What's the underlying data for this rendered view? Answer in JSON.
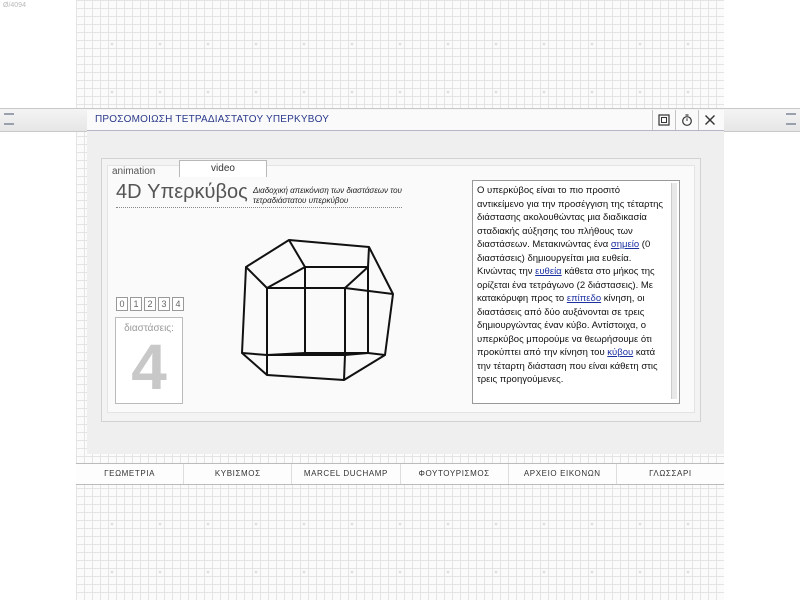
{
  "corner_label": "Ø/4094",
  "window": {
    "title": "ΠΡΟΣΟΜΟΙΩΣΗ ΤΕΤΡΑΔΙΑΣΤΑΤΟΥ ΥΠΕΡΚΥΒΟΥ"
  },
  "tabs": {
    "animation": "animation",
    "video": "video"
  },
  "heading": "4D Υπερκύβος",
  "subheading": "Διαδοχική απεικόνιση των διαστάσεων του τετραδιάστατου υπερκύβου",
  "dimension_buttons": [
    "0",
    "1",
    "2",
    "3",
    "4"
  ],
  "dimension": {
    "label": "διαστάσεις:",
    "value": "4"
  },
  "description": {
    "p1": "Ο υπερκύβος είναι το πιο προσιτό αντικείμενο για την προσέγγιση της τέταρτης διάστασης ακολουθώντας μια διαδικασία σταδιακής αύξησης του πλήθους των διαστάσεων. Μετακινώντας ένα ",
    "link1": "σημείο",
    "p2": " (0 διαστάσεις) δημιουργείται μια ευθεία. Κινώντας την ",
    "link2": "ευθεία",
    "p3": " κάθετα στο μήκος της ορίζεται ένα τετράγωνο (2 διάστασεις). Με κατακόρυφη προς το ",
    "link3": "επίπεδο",
    "p4": " κίνηση, οι διαστάσεις από δύο αυξάνονται σε τρεις δημιουργώντας έναν κύβο. Αντίστοιχα, ο υπερκύβος μπορούμε να θεωρήσουμε ότι προκύπτει από την κίνηση του ",
    "link4": "κύβου",
    "p5": " κατά την τέταρτη διάσταση που είναι κάθετη στις τρεις προηγούμενες."
  },
  "nav": [
    "ΓΕΩΜΕΤΡΙΑ",
    "ΚΥΒΙΣΜΟΣ",
    "MARCEL DUCHAMP",
    "ΦΟΥΤΟΥΡΙΣΜΟΣ",
    "ΑΡΧΕΙΟ ΕΙΚΟΝΩΝ",
    "ΓΛΩΣΣΑΡΙ"
  ]
}
